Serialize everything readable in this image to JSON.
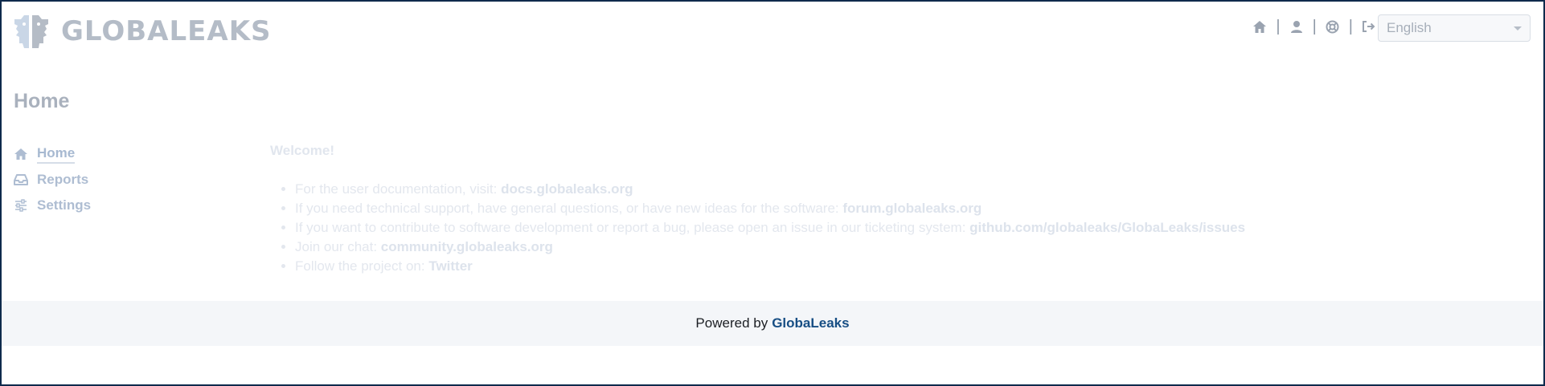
{
  "app": {
    "logo_text": "GLOBALEAKS",
    "logo_icon": "whistleblower-faces-logo"
  },
  "topnav": {
    "icons": [
      "home-icon",
      "user-icon",
      "help-lifebuoy-icon",
      "logout-icon"
    ],
    "separator": "|"
  },
  "language": {
    "selected": "English"
  },
  "page": {
    "title": "Home"
  },
  "sidebar": {
    "items": [
      {
        "label": "Home",
        "icon": "home-icon",
        "active": true
      },
      {
        "label": "Reports",
        "icon": "inbox-icon",
        "active": false
      },
      {
        "label": "Settings",
        "icon": "sliders-icon",
        "active": false
      }
    ]
  },
  "main": {
    "welcome": "Welcome!",
    "links": [
      {
        "text": "For the user documentation, visit:",
        "link": "docs.globaleaks.org"
      },
      {
        "text": "If you need technical support, have general questions, or have new ideas for the software:",
        "link": "forum.globaleaks.org"
      },
      {
        "text": "If you want to contribute to software development or report a bug, please open an issue in our ticketing system:",
        "link": "github.com/globaleaks/GlobaLeaks/issues"
      },
      {
        "text": "Join our chat:",
        "link": "community.globaleaks.org"
      },
      {
        "text": "Follow the project on:",
        "link": "Twitter"
      }
    ]
  },
  "footer": {
    "prefix": "Powered by",
    "link": "GlobaLeaks"
  },
  "colors": {
    "brand_dark": "#0e2a4c",
    "footer_link": "#174e84",
    "muted": "#b4bcc7"
  }
}
